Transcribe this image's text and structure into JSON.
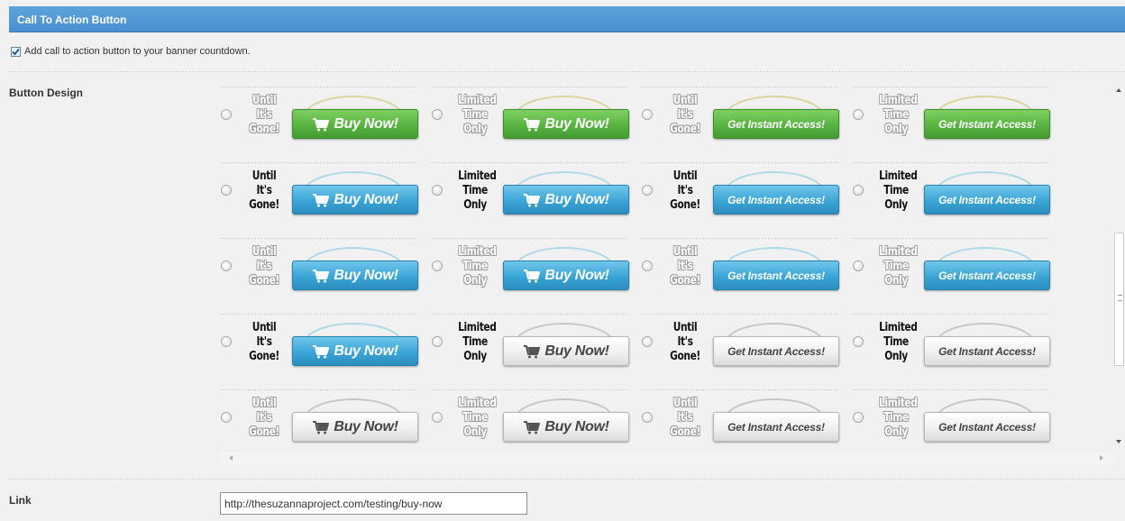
{
  "section": {
    "title": "Call To Action Button"
  },
  "enable": {
    "checked": true,
    "label": "Add call to action button to your banner countdown."
  },
  "button_design": {
    "label": "Button Design",
    "selected": null,
    "rows": [
      [
        {
          "text_lines": [
            "Until",
            "It's",
            "Gone!"
          ],
          "text_style": "outline",
          "button_text": "Buy Now!",
          "button_color": "green",
          "has_cart": true
        },
        {
          "text_lines": [
            "Limited",
            "Time",
            "Only"
          ],
          "text_style": "outline",
          "button_text": "Buy Now!",
          "button_color": "green",
          "has_cart": true
        },
        {
          "text_lines": [
            "Until",
            "It's",
            "Gone!"
          ],
          "text_style": "outline",
          "button_text": "Get Instant Access!",
          "button_color": "green",
          "has_cart": false
        },
        {
          "text_lines": [
            "Limited",
            "Time",
            "Only"
          ],
          "text_style": "outline",
          "button_text": "Get Instant Access!",
          "button_color": "green",
          "has_cart": false
        }
      ],
      [
        {
          "text_lines": [
            "Until",
            "It's",
            "Gone!"
          ],
          "text_style": "solid",
          "button_text": "Buy Now!",
          "button_color": "blue",
          "has_cart": true
        },
        {
          "text_lines": [
            "Limited",
            "Time",
            "Only"
          ],
          "text_style": "solid",
          "button_text": "Buy Now!",
          "button_color": "blue",
          "has_cart": true
        },
        {
          "text_lines": [
            "Until",
            "It's",
            "Gone!"
          ],
          "text_style": "solid",
          "button_text": "Get Instant Access!",
          "button_color": "blue",
          "has_cart": false
        },
        {
          "text_lines": [
            "Limited",
            "Time",
            "Only"
          ],
          "text_style": "solid",
          "button_text": "Get Instant Access!",
          "button_color": "blue",
          "has_cart": false
        }
      ],
      [
        {
          "text_lines": [
            "Until",
            "It's",
            "Gone!"
          ],
          "text_style": "outline",
          "button_text": "Buy Now!",
          "button_color": "blue",
          "has_cart": true
        },
        {
          "text_lines": [
            "Limited",
            "Time",
            "Only"
          ],
          "text_style": "outline",
          "button_text": "Buy Now!",
          "button_color": "blue",
          "has_cart": true
        },
        {
          "text_lines": [
            "Until",
            "It's",
            "Gone!"
          ],
          "text_style": "outline",
          "button_text": "Get Instant Access!",
          "button_color": "blue",
          "has_cart": false
        },
        {
          "text_lines": [
            "Limited",
            "Time",
            "Only"
          ],
          "text_style": "outline",
          "button_text": "Get Instant Access!",
          "button_color": "blue",
          "has_cart": false
        }
      ],
      [
        {
          "text_lines": [
            "Until",
            "It's",
            "Gone!"
          ],
          "text_style": "solid",
          "button_text": "Buy Now!",
          "button_color": "blue",
          "has_cart": true
        },
        {
          "text_lines": [
            "Limited",
            "Time",
            "Only"
          ],
          "text_style": "solid",
          "button_text": "Buy Now!",
          "button_color": "gray",
          "has_cart": true
        },
        {
          "text_lines": [
            "Until",
            "It's",
            "Gone!"
          ],
          "text_style": "solid",
          "button_text": "Get Instant Access!",
          "button_color": "gray",
          "has_cart": false
        },
        {
          "text_lines": [
            "Limited",
            "Time",
            "Only"
          ],
          "text_style": "solid",
          "button_text": "Get Instant Access!",
          "button_color": "gray",
          "has_cart": false
        }
      ],
      [
        {
          "text_lines": [
            "Until",
            "It's",
            "Gone!"
          ],
          "text_style": "outline",
          "button_text": "Buy Now!",
          "button_color": "gray",
          "has_cart": true
        },
        {
          "text_lines": [
            "Limited",
            "Time",
            "Only"
          ],
          "text_style": "outline",
          "button_text": "Buy Now!",
          "button_color": "gray",
          "has_cart": true
        },
        {
          "text_lines": [
            "Until",
            "It's",
            "Gone!"
          ],
          "text_style": "outline",
          "button_text": "Get Instant Access!",
          "button_color": "gray",
          "has_cart": false
        },
        {
          "text_lines": [
            "Limited",
            "Time",
            "Only"
          ],
          "text_style": "outline",
          "button_text": "Get Instant Access!",
          "button_color": "gray",
          "has_cart": false
        }
      ]
    ]
  },
  "link": {
    "label": "Link",
    "value": "http://thesuzannaproject.com/testing/buy-now"
  },
  "colors": {
    "header_blue": "#4a90d0",
    "button_green": "#58b441",
    "button_blue": "#3aa5d6",
    "button_gray": "#eeeeee"
  },
  "icons": {
    "cart": "shopping-cart-icon",
    "checkbox": "checkmark-icon"
  }
}
